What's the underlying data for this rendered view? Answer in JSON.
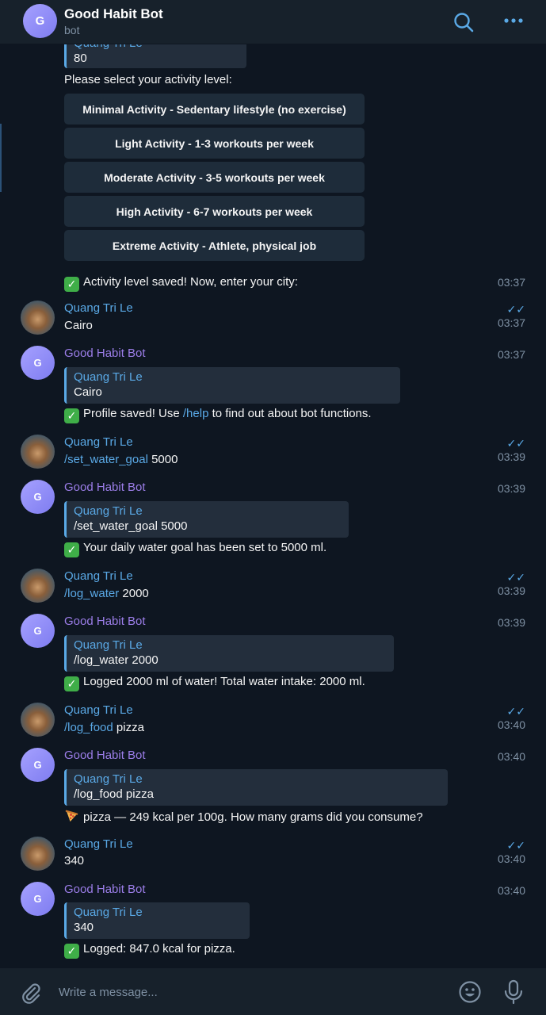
{
  "header": {
    "avatar_letter": "G",
    "title": "Good Habit Bot",
    "subtitle": "bot"
  },
  "top_fragment": {
    "quote_name": "Quang Tri Le",
    "quote_text": "80",
    "prompt": "Please select your activity level:",
    "buttons": [
      "Minimal Activity - Sedentary lifestyle (no exercise)",
      "Light Activity - 1-3 workouts per week",
      "Moderate Activity - 3-5 workouts per week",
      "High Activity - 6-7 workouts per week",
      "Extreme Activity - Athlete, physical job"
    ],
    "saved_text": "Activity level saved! Now, enter your city:",
    "saved_time": "03:37"
  },
  "messages": [
    {
      "sender": "Quang Tri Le",
      "time": "03:37",
      "text": "Cairo"
    },
    {
      "sender": "Good Habit Bot",
      "time": "03:37",
      "quote_name": "Quang Tri Le",
      "quote_text": "Cairo",
      "text_before": "Profile saved! Use ",
      "cmd": "/help",
      "text_after": " to find out about bot functions."
    },
    {
      "sender": "Quang Tri Le",
      "time": "03:39",
      "cmd": "/set_water_goal",
      "text": " 5000"
    },
    {
      "sender": "Good Habit Bot",
      "time": "03:39",
      "quote_name": "Quang Tri Le",
      "quote_text": "/set_water_goal 5000",
      "text": "Your daily water goal has been set to 5000 ml."
    },
    {
      "sender": "Quang Tri Le",
      "time": "03:39",
      "cmd": "/log_water",
      "text": " 2000"
    },
    {
      "sender": "Good Habit Bot",
      "time": "03:39",
      "quote_name": "Quang Tri Le",
      "quote_text": "/log_water 2000",
      "text": "Logged 2000 ml of water! Total water intake: 2000 ml."
    },
    {
      "sender": "Quang Tri Le",
      "time": "03:40",
      "cmd": "/log_food",
      "text": " pizza"
    },
    {
      "sender": "Good Habit Bot",
      "time": "03:40",
      "quote_name": "Quang Tri Le",
      "quote_text": "/log_food pizza",
      "text": "pizza — 249 kcal per 100g. How many grams did you consume?"
    },
    {
      "sender": "Quang Tri Le",
      "time": "03:40",
      "text": "340"
    },
    {
      "sender": "Good Habit Bot",
      "time": "03:40",
      "quote_name": "Quang Tri Le",
      "quote_text": "340",
      "text": "Logged: 847.0 kcal for pizza."
    }
  ],
  "bot_avatar_letter": "G",
  "footer": {
    "placeholder": "Write a message..."
  },
  "colors": {
    "background": "#0e1621",
    "header": "#17212b",
    "accent": "#5aa9e6",
    "bot_name": "#9c7ee9",
    "button": "#1e2c3a",
    "quote": "#232e3c"
  }
}
